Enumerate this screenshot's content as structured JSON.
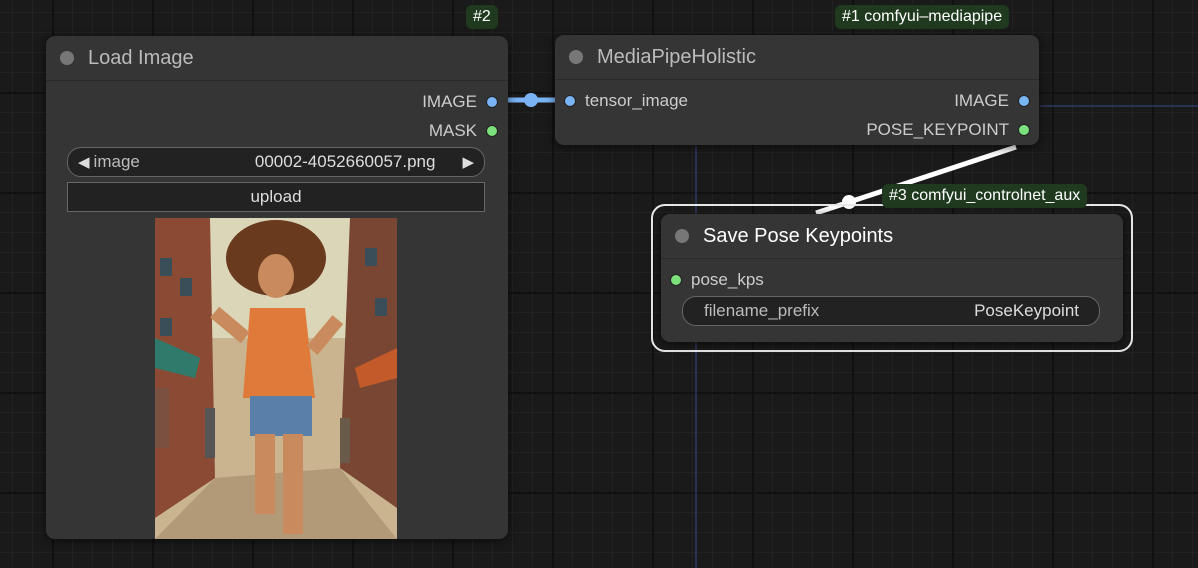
{
  "badges": {
    "load_image": "#2",
    "mediapipe": "#1 comfyui–mediapipe",
    "save_pose": "#3 comfyui_controlnet_aux"
  },
  "load_image_node": {
    "title": "Load Image",
    "outputs": [
      "IMAGE",
      "MASK"
    ],
    "image_widget": {
      "label": "image",
      "value": "00002-4052660057.png"
    },
    "upload_label": "upload"
  },
  "mediapipe_node": {
    "title": "MediaPipeHolistic",
    "input": "tensor_image",
    "outputs": [
      "IMAGE",
      "POSE_KEYPOINT"
    ]
  },
  "save_pose_node": {
    "title": "Save Pose Keypoints",
    "input": "pose_kps",
    "widget": {
      "label": "filename_prefix",
      "value": "PoseKeypoint"
    }
  },
  "colors": {
    "image_link": "#7ab4f5",
    "pose_link": "#ffffff",
    "badge_bg": "#1f3a1f"
  }
}
